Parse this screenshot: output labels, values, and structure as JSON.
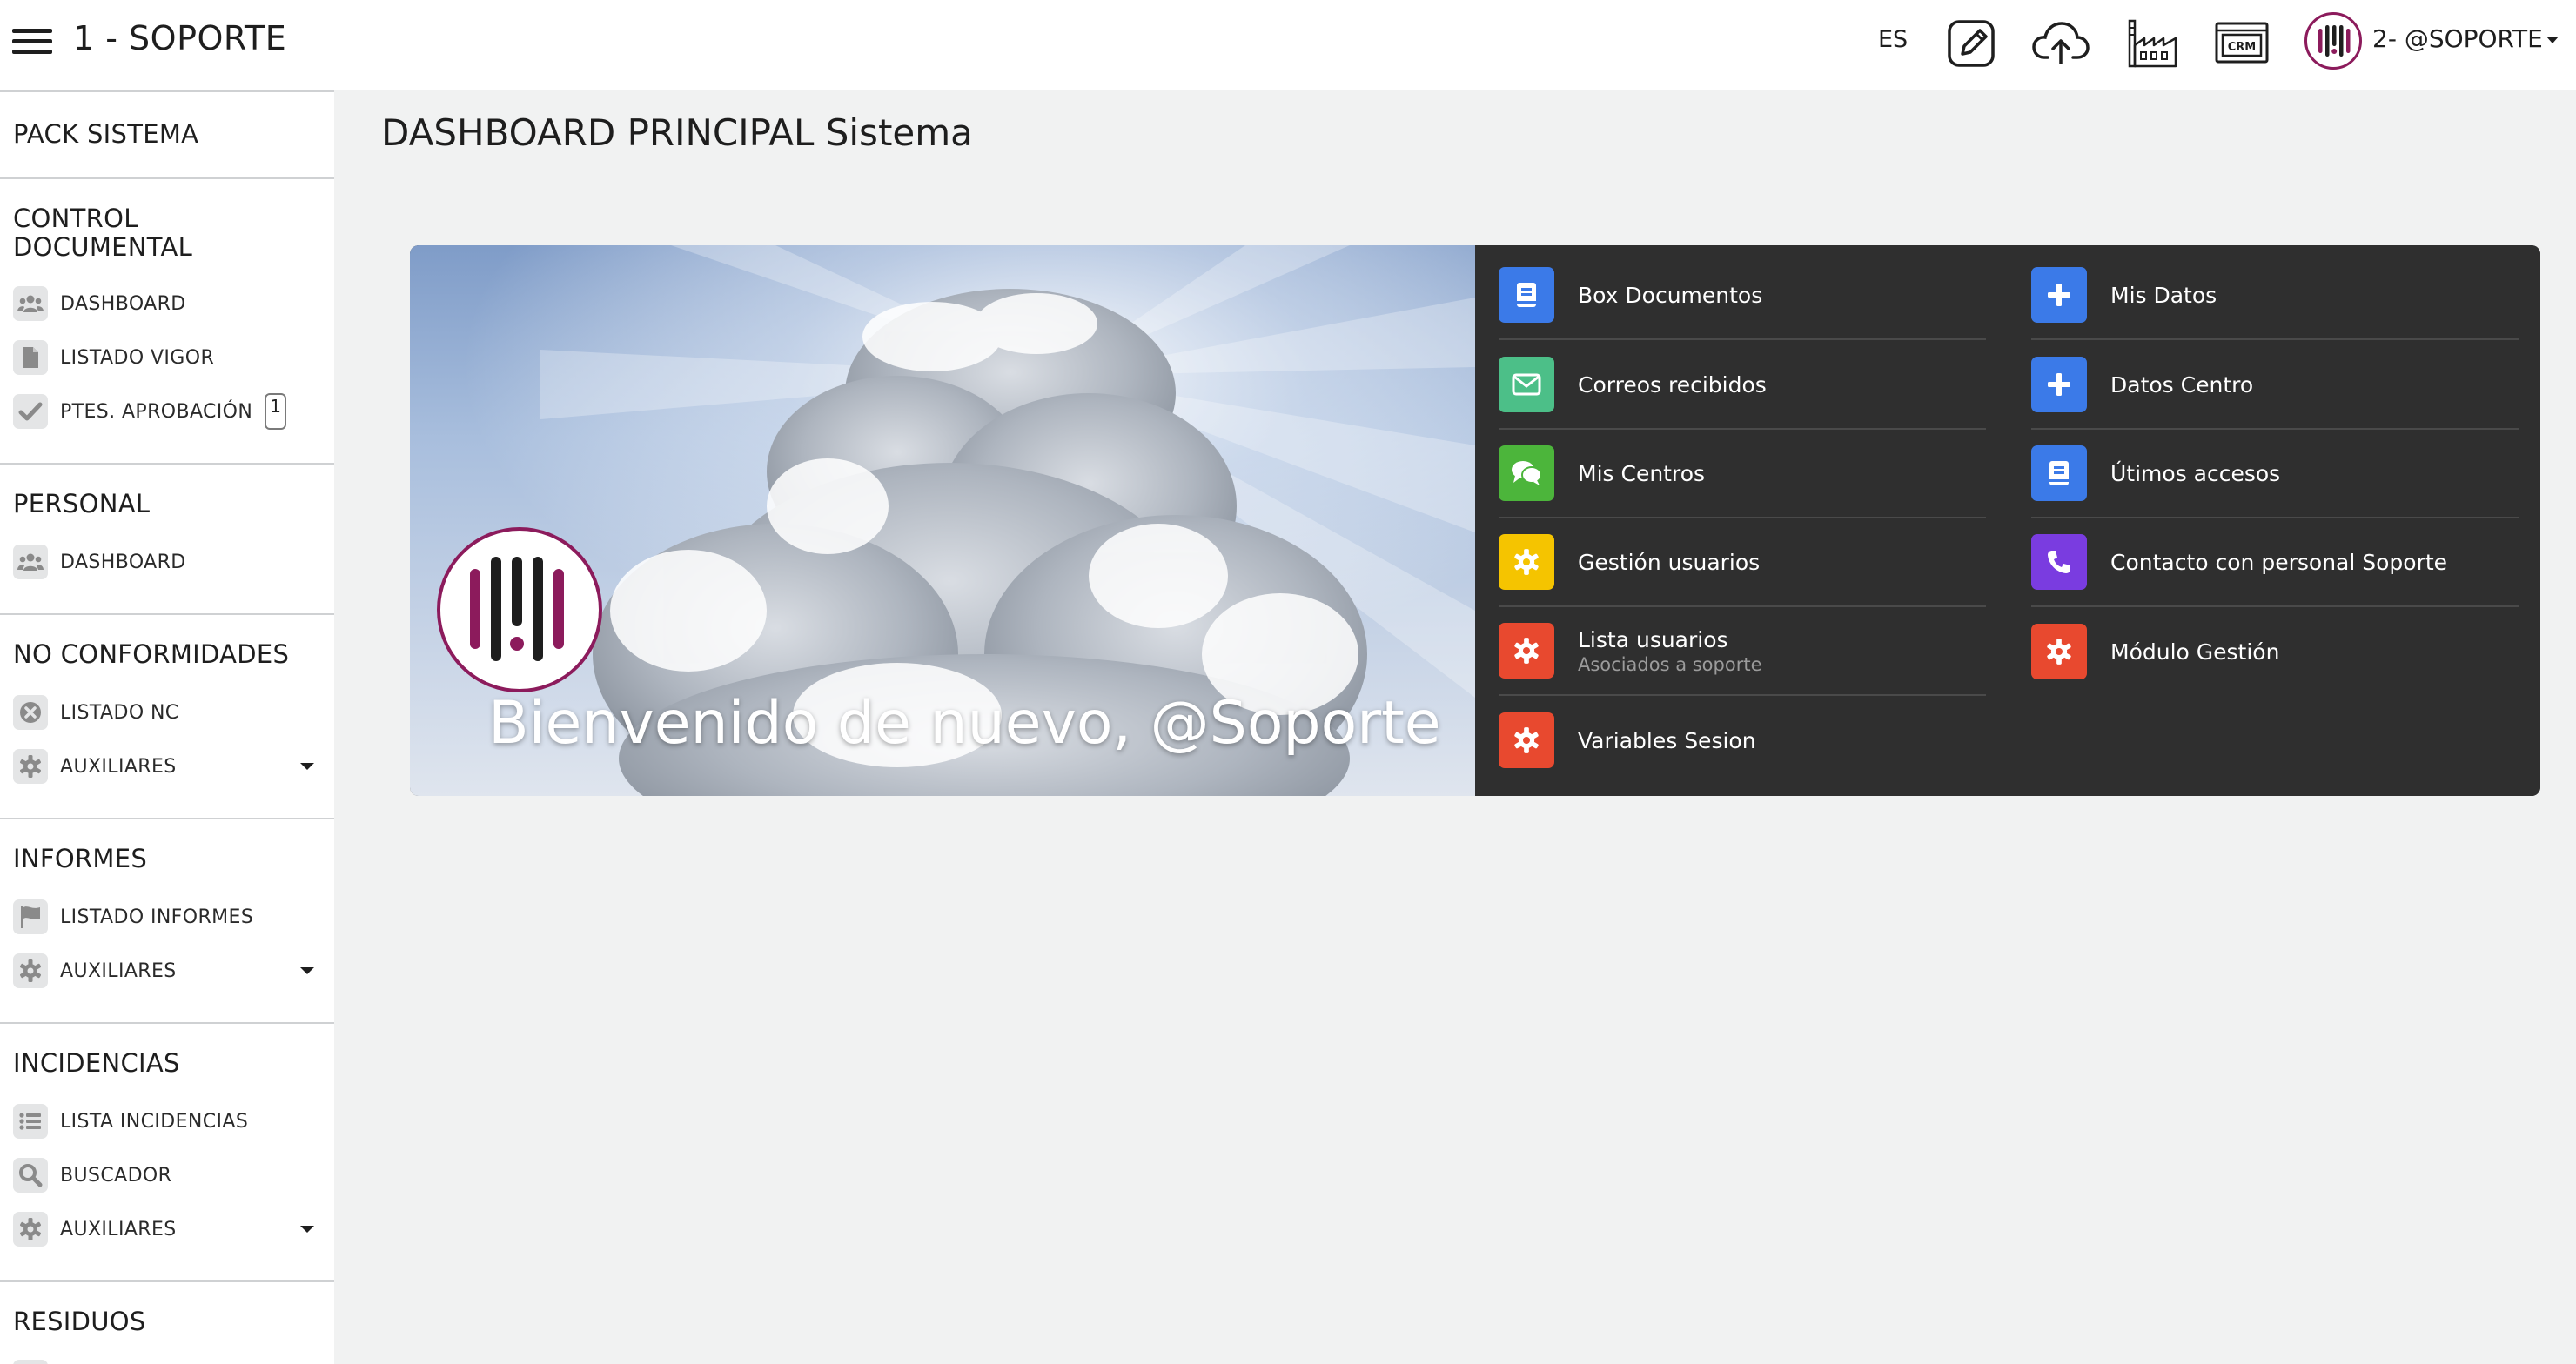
{
  "header": {
    "title": "1 - SOPORTE",
    "language": "ES",
    "icons": [
      "edit-icon",
      "cloud-upload-icon",
      "factory-icon",
      "crm-icon"
    ],
    "crm_text": "CRM",
    "user": {
      "name": "2- @SOPORTE"
    }
  },
  "sidebar": {
    "pack": "PACK SISTEMA",
    "sections": [
      {
        "title": "CONTROL DOCUMENTAL",
        "items": [
          {
            "label": "DASHBOARD",
            "icon": "users-icon"
          },
          {
            "label": "LISTADO VIGOR",
            "icon": "document-icon"
          },
          {
            "label": "PTES. APROBACIÓN",
            "icon": "check-icon",
            "badge": "1"
          }
        ]
      },
      {
        "title": "PERSONAL",
        "items": [
          {
            "label": "DASHBOARD",
            "icon": "users-icon"
          }
        ]
      },
      {
        "title": "NO CONFORMIDADES",
        "items": [
          {
            "label": "LISTADO NC",
            "icon": "times-circle-icon"
          },
          {
            "label": "AUXILIARES",
            "icon": "gear-icon"
          }
        ]
      },
      {
        "title": "INFORMES",
        "items": [
          {
            "label": "LISTADO INFORMES",
            "icon": "flag-icon"
          },
          {
            "label": "AUXILIARES",
            "icon": "gear-icon"
          }
        ]
      },
      {
        "title": "INCIDENCIAS",
        "items": [
          {
            "label": "LISTA INCIDENCIAS",
            "icon": "list-icon"
          },
          {
            "label": "BUSCADOR",
            "icon": "search-icon"
          },
          {
            "label": "AUXILIARES",
            "icon": "gear-icon"
          }
        ]
      },
      {
        "title": "RESIDUOS",
        "items": []
      }
    ]
  },
  "main": {
    "title": "DASHBOARD PRINCIPAL Sistema",
    "welcome": "Bienvenido de nuevo, @Soporte",
    "links_left": [
      {
        "label": "Box Documentos",
        "icon": "book-icon",
        "color": "#3b7ae8"
      },
      {
        "label": "Correos recibidos",
        "icon": "envelope-icon",
        "color": "#4cbf88"
      },
      {
        "label": "Mis Centros",
        "icon": "chat-icon",
        "color": "#4cb53b"
      },
      {
        "label": "Gestión usuarios",
        "icon": "gear-icon",
        "color": "#f5c400"
      },
      {
        "label": "Lista usuarios",
        "sub": "Asociados a soporte",
        "icon": "gear-icon",
        "color": "#e8492f"
      },
      {
        "label": "Variables Sesion",
        "icon": "gear-icon",
        "color": "#e8492f"
      }
    ],
    "links_right": [
      {
        "label": "Mis Datos",
        "icon": "plus-icon",
        "color": "#3b7ae8"
      },
      {
        "label": "Datos Centro",
        "icon": "plus-icon",
        "color": "#3b7ae8"
      },
      {
        "label": "Útimos accesos",
        "icon": "book-icon",
        "color": "#3b7ae8"
      },
      {
        "label": "Contacto con personal Soporte",
        "icon": "phone-icon",
        "color": "#7a3ce0"
      },
      {
        "label": "Módulo Gestión",
        "icon": "gear-icon",
        "color": "#e8492f"
      }
    ]
  }
}
